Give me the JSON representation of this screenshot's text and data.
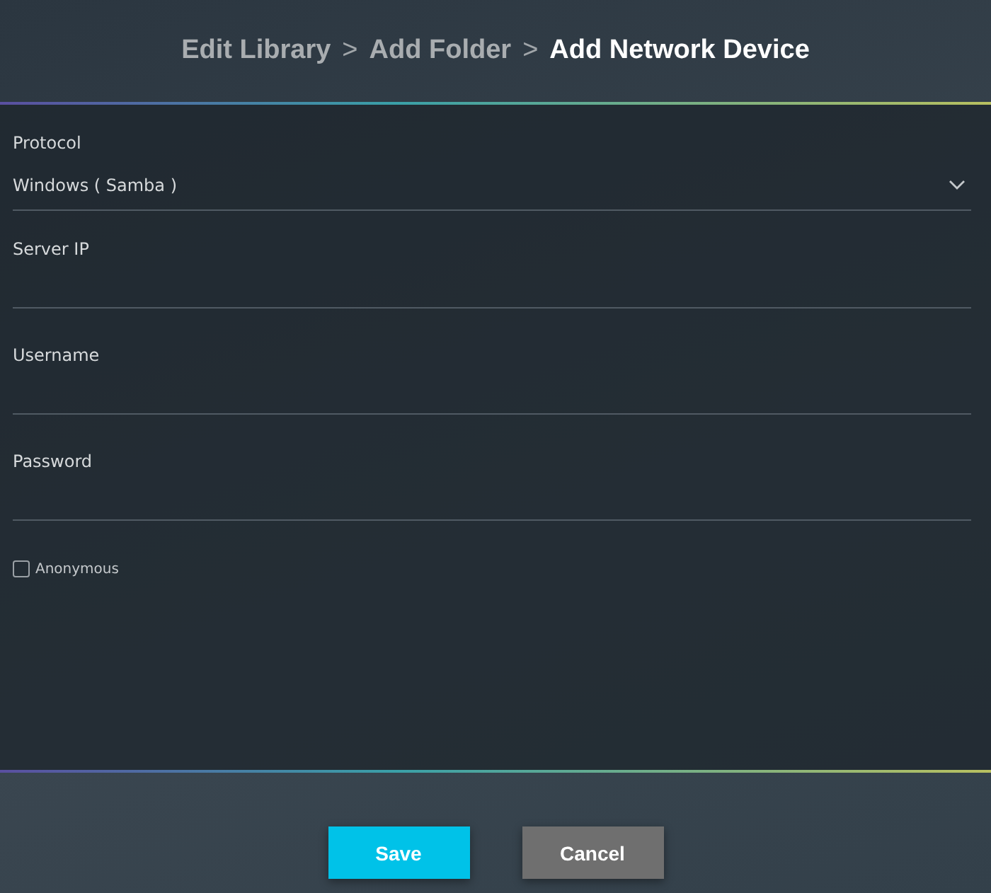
{
  "breadcrumb": [
    {
      "label": "Edit Library",
      "current": false
    },
    {
      "label": ">",
      "kind": "separator"
    },
    {
      "label": "Add Folder",
      "current": false
    },
    {
      "label": ">",
      "kind": "separator"
    },
    {
      "label": "Add Network Device",
      "current": true
    }
  ],
  "fields": [
    {
      "kind": "select",
      "label": "Protocol",
      "value": "Windows ( Samba )"
    },
    {
      "kind": "text",
      "label": "Server IP"
    },
    {
      "kind": "text",
      "label": "Username"
    },
    {
      "kind": "password",
      "label": "Password"
    }
  ],
  "anonymous": {
    "label": "Anonymous",
    "checked": false
  },
  "buttons": [
    {
      "label": "Save",
      "kind": "primary"
    },
    {
      "label": "Cancel",
      "kind": "secondary"
    }
  ]
}
